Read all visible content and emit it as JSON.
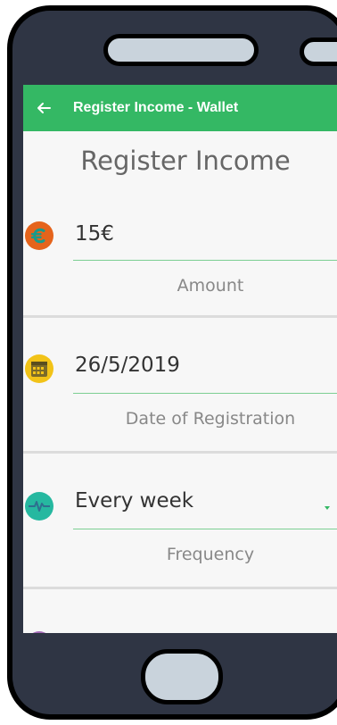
{
  "appbar": {
    "title": "Register Income - Wallet",
    "back_icon": "arrow-left-icon"
  },
  "page": {
    "title": "Register Income"
  },
  "fields": {
    "amount": {
      "value": "15€",
      "label": "Amount",
      "icon": "euro-icon",
      "color": "#e5641c"
    },
    "date": {
      "value": "26/5/2019",
      "label": "Date of Registration",
      "icon": "calendar-icon",
      "color": "#f2c318"
    },
    "frequency": {
      "value": "Every week",
      "label": "Frequency",
      "icon": "pulse-icon",
      "color": "#26b8a0"
    }
  },
  "colors": {
    "accent": "#34b864",
    "phone_body": "#2f3544"
  }
}
